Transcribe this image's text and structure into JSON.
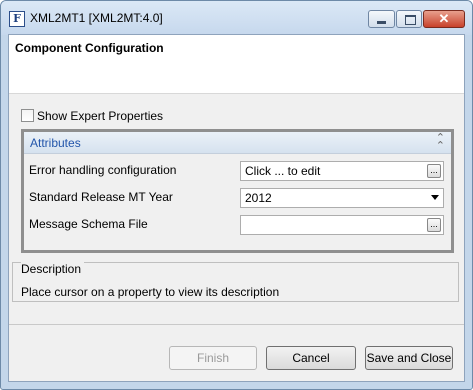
{
  "window": {
    "title": "XML2MT1 [XML2MT:4.0]",
    "app_icon_letter": "F"
  },
  "header": {
    "title": "Component Configuration"
  },
  "expert": {
    "label": "Show Expert Properties",
    "checked": false
  },
  "attributes": {
    "title": "Attributes",
    "properties": [
      {
        "label": "Error handling configuration",
        "value": "Click ... to edit",
        "control": "ellipsis"
      },
      {
        "label": "Standard Release MT Year",
        "value": "2012",
        "control": "dropdown"
      },
      {
        "label": "Message Schema File",
        "value": "",
        "control": "ellipsis"
      }
    ]
  },
  "description": {
    "title": "Description",
    "text": "Place cursor on a property to view its description"
  },
  "buttons": {
    "finish": "Finish",
    "cancel": "Cancel",
    "save_close": "Save and Close"
  },
  "icons": {
    "ellipsis": "...",
    "close": "✕",
    "collapse": "⌃⌃"
  }
}
